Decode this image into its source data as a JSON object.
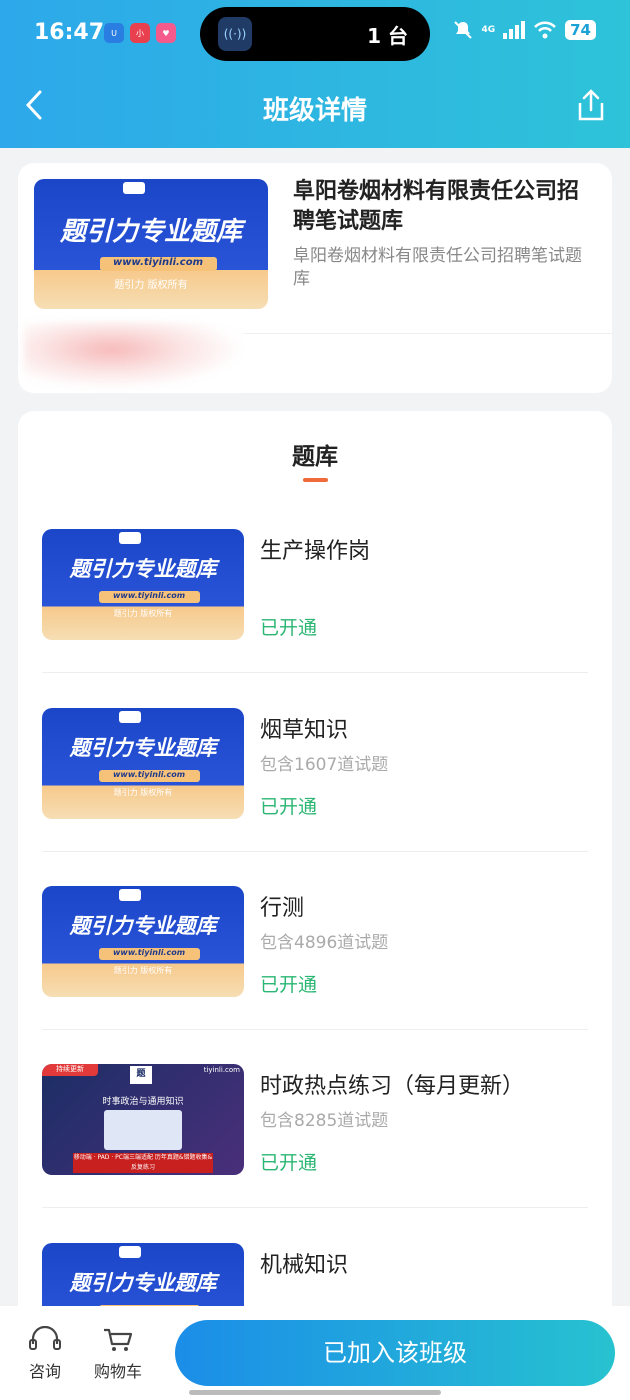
{
  "status_bar": {
    "time": "16:47",
    "island_count": "1 台",
    "network": "4G",
    "battery": "74"
  },
  "nav": {
    "title": "班级详情"
  },
  "class_card": {
    "banner": {
      "headline": "题引力专业题库",
      "url": "www.tiyinli.com",
      "copyright": "题引力 版权所有"
    },
    "title": "阜阳卷烟材料有限责任公司招聘笔试题库",
    "subtitle": "阜阳卷烟材料有限责任公司招聘笔试题库"
  },
  "question_bank": {
    "section_title": "题库",
    "items": [
      {
        "name": "生产操作岗",
        "count": "",
        "status": "已开通"
      },
      {
        "name": "烟草知识",
        "count": "包含1607道试题",
        "status": "已开通"
      },
      {
        "name": "行测",
        "count": "包含4896道试题",
        "status": "已开通"
      },
      {
        "name": "时政热点练习（每月更新）",
        "count": "包含8285道试题",
        "status": "已开通"
      },
      {
        "name": "机械知识",
        "count": "",
        "status": ""
      }
    ],
    "dark_banner": {
      "tag": "持续更新",
      "site": "tiyinli.com",
      "title": "时事政治与通用知识",
      "footer": "移动端 · PAD · PC端三端适配 历年真题&错题收集&反复练习"
    }
  },
  "bottom_bar": {
    "consult_label": "咨询",
    "cart_label": "购物车",
    "join_label": "已加入该班级"
  }
}
